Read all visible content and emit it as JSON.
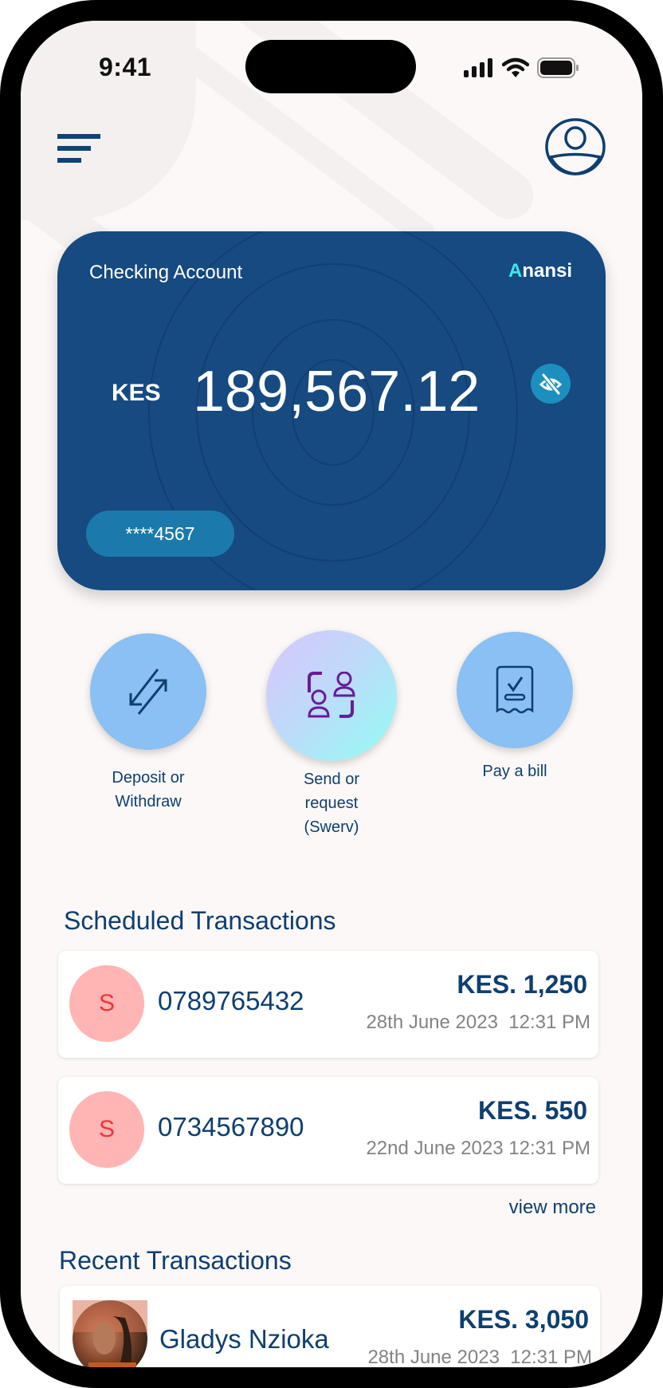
{
  "status_bar": {
    "time": "9:41"
  },
  "header": {
    "menu_icon": "menu-icon",
    "profile_icon": "user-profile-icon"
  },
  "account_card": {
    "title": "Checking Account",
    "brand_first": "A",
    "brand_rest": "nansi",
    "currency": "KES",
    "balance": "189,567.12",
    "masked_account": "****4567",
    "visibility_icon": "eye-off-icon"
  },
  "actions": [
    {
      "label_line1": "Deposit or",
      "label_line2": "Withdraw",
      "label_line3": "",
      "icon": "transfer-arrows-icon"
    },
    {
      "label_line1": "Send or",
      "label_line2": "request",
      "label_line3": "(Swerv)",
      "icon": "exchange-people-icon"
    },
    {
      "label_line1": "Pay a bill",
      "label_line2": "",
      "label_line3": "",
      "icon": "receipt-check-icon"
    }
  ],
  "scheduled": {
    "title": "Scheduled Transactions",
    "items": [
      {
        "initial": "S",
        "name": "0789765432",
        "amount": "KES. 1,250",
        "date": "28th June 2023  12:31 PM"
      },
      {
        "initial": "S",
        "name": "0734567890",
        "amount": "KES. 550",
        "date": "22nd June 2023 12:31 PM"
      }
    ],
    "view_more": "view more"
  },
  "recent": {
    "title": "Recent Transactions",
    "items": [
      {
        "name": "Gladys Nzioka",
        "amount": "KES. 3,050",
        "date": "28th June 2023  12:31 PM"
      }
    ]
  },
  "colors": {
    "primary": "#0e3f70",
    "card": "#164a80",
    "action_blue": "#8ac0f3",
    "avatar_pink": "#ffb5b3",
    "avatar_text": "#f0343a",
    "brand_accent": "#3de8ef"
  }
}
